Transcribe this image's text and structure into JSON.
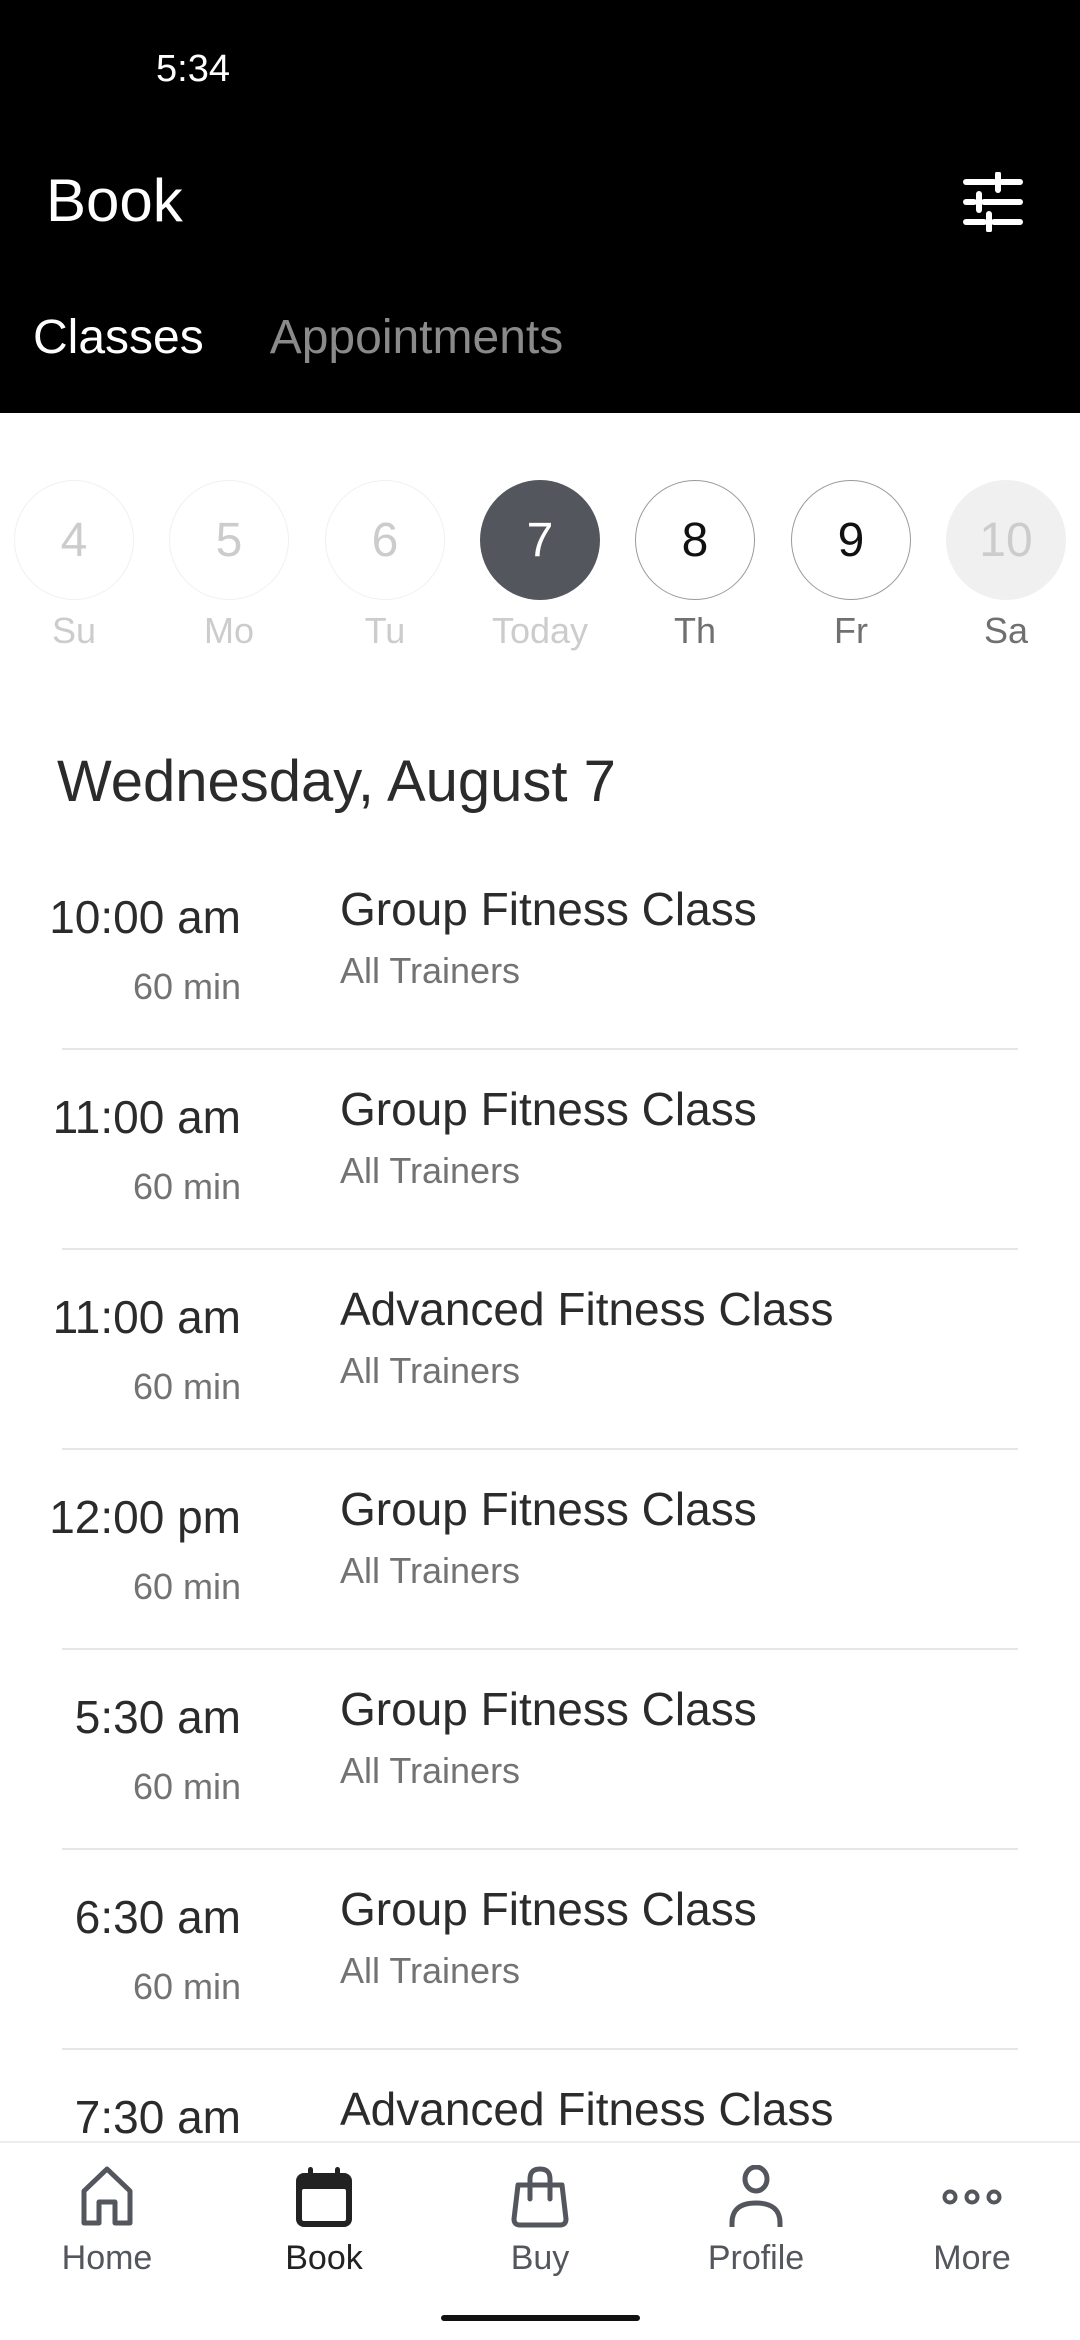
{
  "status_bar": {
    "time": "5:34"
  },
  "header": {
    "title": "Book",
    "filter_icon": "sliders-icon"
  },
  "tabs": [
    {
      "label": "Classes",
      "active": true
    },
    {
      "label": "Appointments",
      "active": false
    }
  ],
  "date_strip": {
    "days": [
      {
        "number": "4",
        "label": "Su",
        "state": "past"
      },
      {
        "number": "5",
        "label": "Mo",
        "state": "past"
      },
      {
        "number": "6",
        "label": "Tu",
        "state": "past"
      },
      {
        "number": "7",
        "label": "Today",
        "state": "selected"
      },
      {
        "number": "8",
        "label": "Th",
        "state": "available"
      },
      {
        "number": "9",
        "label": "Fr",
        "state": "available"
      },
      {
        "number": "10",
        "label": "Sa",
        "state": "unavailable"
      }
    ]
  },
  "schedule": {
    "heading": "Wednesday, August 7",
    "classes": [
      {
        "time": "10:00 am",
        "duration": "60 min",
        "name": "Group Fitness Class",
        "trainer": "All Trainers"
      },
      {
        "time": "11:00 am",
        "duration": "60 min",
        "name": "Group Fitness Class",
        "trainer": "All Trainers"
      },
      {
        "time": "11:00 am",
        "duration": "60 min",
        "name": "Advanced Fitness Class",
        "trainer": "All Trainers"
      },
      {
        "time": "12:00 pm",
        "duration": "60 min",
        "name": "Group Fitness Class",
        "trainer": "All Trainers"
      },
      {
        "time": "5:30 am",
        "duration": "60 min",
        "name": "Group Fitness Class",
        "trainer": "All Trainers"
      },
      {
        "time": "6:30 am",
        "duration": "60 min",
        "name": "Group Fitness Class",
        "trainer": "All Trainers"
      },
      {
        "time": "7:30 am",
        "duration": "",
        "name": "Advanced Fitness Class",
        "trainer": ""
      }
    ]
  },
  "bottom_nav": {
    "items": [
      {
        "label": "Home",
        "icon": "home-icon",
        "active": false
      },
      {
        "label": "Book",
        "icon": "calendar-icon",
        "active": true
      },
      {
        "label": "Buy",
        "icon": "shopping-bag-icon",
        "active": false
      },
      {
        "label": "Profile",
        "icon": "person-icon",
        "active": false
      },
      {
        "label": "More",
        "icon": "more-dots-icon",
        "active": false
      }
    ]
  },
  "colors": {
    "header_bg": "#000000",
    "selected_date": "#53565c",
    "icon_gray": "#53565c",
    "divider": "#e6e6e6"
  }
}
